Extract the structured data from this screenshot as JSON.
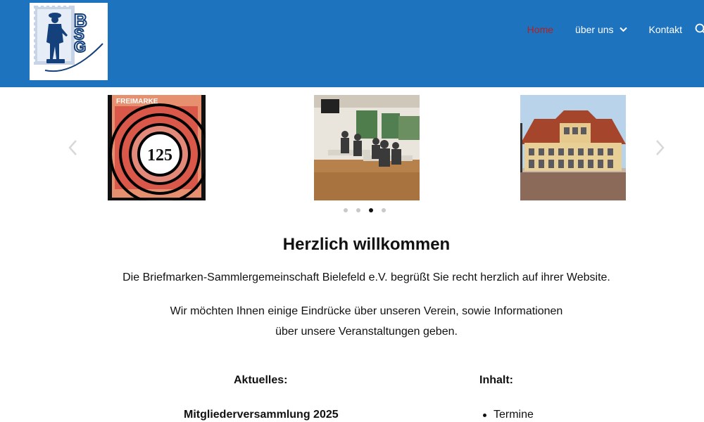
{
  "header": {
    "logo_text": "BSG",
    "logo_subtext": "Briefmarken-Sammlergemeinschaft Bielefeld e.V.",
    "nav": [
      {
        "label": "Home",
        "active": true
      },
      {
        "label": "über uns",
        "has_dropdown": true
      },
      {
        "label": "Kontakt"
      }
    ],
    "search_icon": "search-icon"
  },
  "slider": {
    "slides": [
      {
        "stamp_header": "FREIMARKE",
        "stamp_value": "125"
      },
      {},
      {}
    ],
    "dots": {
      "count": 4,
      "active_index": 2
    },
    "prev_icon": "chevron-left-icon",
    "next_icon": "chevron-right-icon"
  },
  "content": {
    "title": "Herzlich willkommen",
    "intro": "Die Briefmarken-Sammlergemeinschaft Bielefeld e.V. begrüßt Sie recht herzlich auf ihrer Website.",
    "text_line1": "Wir möchten Ihnen einige Eindrücke über unseren Verein, sowie Informationen",
    "text_line2": "über unsere Veranstaltungen geben.",
    "aktuelles_heading": "Aktuelles:",
    "event_title": "Mitgliederversammlung 2025",
    "inhalt_heading": "Inhalt:",
    "toc": [
      "Termine"
    ]
  },
  "colors": {
    "header_bg": "#1e73be",
    "active_nav": "#b22222",
    "logo_blue": "#14407c"
  }
}
